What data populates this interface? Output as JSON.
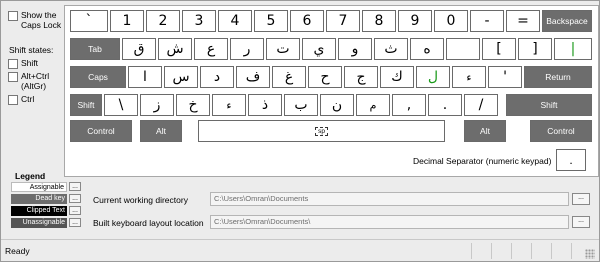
{
  "options": {
    "show_caps_lock": "Show the Caps Lock",
    "shift_states_title": "Shift states:",
    "shift": "Shift",
    "altctrl_line1": "Alt+Ctrl",
    "altctrl_line2": "(AltGr)",
    "ctrl": "Ctrl"
  },
  "keyboard": {
    "row1": [
      "`",
      "1",
      "2",
      "3",
      "4",
      "5",
      "6",
      "7",
      "8",
      "9",
      "0",
      "-",
      "=",
      "Backspace"
    ],
    "row2": [
      "Tab",
      "ق",
      "ش",
      "ع",
      "ر",
      "ت",
      "ي",
      "و",
      "ث",
      "ه",
      "",
      "[",
      "]",
      "|"
    ],
    "row3": [
      "Caps",
      "ا",
      "س",
      "د",
      "ف",
      "غ",
      "ح",
      "ج",
      "ك",
      "ل",
      "ء",
      "'",
      "Return"
    ],
    "row4": [
      "Shift",
      "\\",
      "ز",
      "خ",
      "ء",
      "ذ",
      "ب",
      "ن",
      "م",
      ",",
      ".",
      "/",
      "Shift"
    ],
    "row5": [
      "Control",
      "Alt",
      "sp",
      "Alt",
      "Control"
    ]
  },
  "decimal_separator": {
    "label": "Decimal Separator (numeric keypad)",
    "value": "."
  },
  "legend": {
    "title": "Legend",
    "items": [
      "Assignable",
      "Dead key",
      "Clipped Text",
      "Unassignable"
    ],
    "dots": "..."
  },
  "paths": {
    "working_dir_label": "Current working directory",
    "working_dir_value": "C:\\Users\\Omran\\Documents",
    "build_label": "Built keyboard layout location",
    "build_value": "C:\\Users\\Omran\\Documents\\",
    "browse": "..."
  },
  "status": {
    "text": "Ready"
  }
}
